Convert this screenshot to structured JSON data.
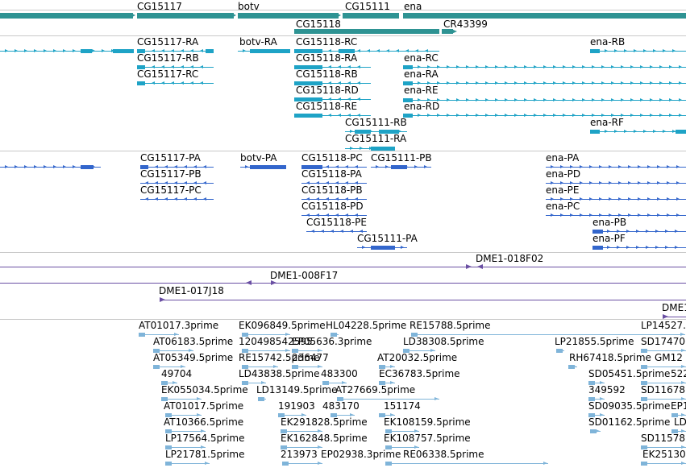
{
  "tracks": {
    "genes": {
      "color": "#2e9393",
      "labels": [
        "CG15117",
        "botv",
        "CG15111",
        "ena",
        "CG15118",
        "CR43399"
      ]
    },
    "transcripts": {
      "color": "#1ea3c6",
      "labels": [
        "CG15117-RA",
        "botv-RA",
        "CG15118-RC",
        "ena-RB",
        "CG15117-RB",
        "CG15118-RA",
        "ena-RC",
        "CG15117-RC",
        "CG15118-RB",
        "ena-RA",
        "CG15118-RD",
        "ena-RE",
        "CG15118-RE",
        "ena-RD",
        "CG15111-RB",
        "ena-RF",
        "CG15111-RA"
      ]
    },
    "proteins": {
      "color": "#3366cc",
      "labels": [
        "CG15117-PA",
        "botv-PA",
        "CG15118-PC",
        "CG15111-PB",
        "ena-PA",
        "CG15117-PB",
        "CG15118-PA",
        "ena-PD",
        "CG15117-PC",
        "CG15118-PB",
        "ena-PE",
        "CG15118-PD",
        "ena-PC",
        "CG15118-PE",
        "ena-PB",
        "CG15111-PA",
        "ena-PF"
      ]
    },
    "clones": {
      "color": "#6a4fa3",
      "labels": [
        "DME1-018F02",
        "DME1-008F17",
        "DME1-017J18",
        "DME1"
      ]
    },
    "ests": {
      "color": "#7fb4d9",
      "labels": [
        "AT01017.3prime",
        "EK096849.5prime",
        "HL04228.5prime",
        "RE15788.5prime",
        "LP14527.",
        "AT06183.5prime",
        "120498542595",
        "EP05636.3prime",
        "LD38308.5prime",
        "LP21855.5prime",
        "SD17470",
        "AT05349.5prime",
        "RE15742.5prime",
        "236477",
        "AT20032.5prime",
        "RH67418.5prime",
        "GM12",
        "49704",
        "LD43838.5prime",
        "483300",
        "EC36783.5prime",
        "SD05451.5prime",
        "522",
        "EK055034.5prime",
        "LD13149.5prime",
        "AT27669.5prime",
        "349592",
        "SD11678",
        "AT01017.5prime",
        "191903",
        "483170",
        "151174",
        "SD09035.5prime",
        "EP1",
        "AT10366.5prime",
        "EK291828.5prime",
        "EK108159.5prime",
        "SD01162.5prime",
        "LD",
        "LP17564.5prime",
        "EK162848.5prime",
        "EK108757.5prime",
        "SD11578",
        "LP21781.5prime",
        "213973",
        "EP02938.3prime",
        "RE06338.5prime",
        "EK25130"
      ]
    }
  }
}
